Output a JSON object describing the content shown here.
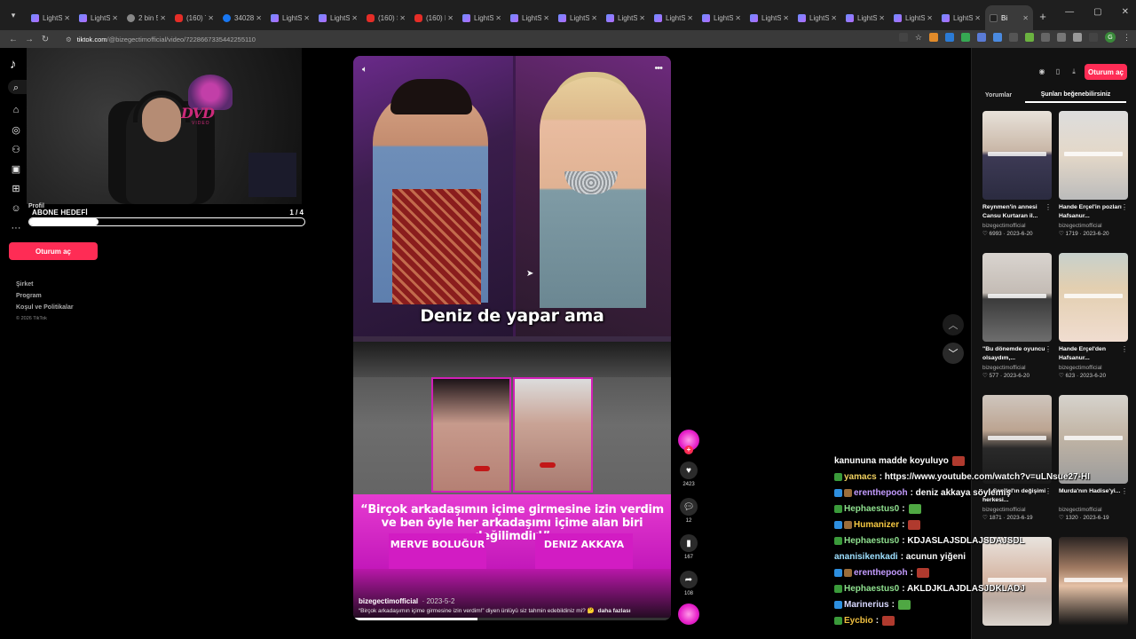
{
  "browser": {
    "tabs": [
      {
        "title": "LightS",
        "icon": "lightstream-icon"
      },
      {
        "title": "LightS",
        "icon": "lightstream-icon"
      },
      {
        "title": "2 bin 5",
        "icon": "globe-icon"
      },
      {
        "title": "(160) T",
        "icon": "youtube-icon"
      },
      {
        "title": "34028",
        "icon": "facebook-icon"
      },
      {
        "title": "LightS",
        "icon": "lightstream-icon"
      },
      {
        "title": "LightS",
        "icon": "lightstream-icon"
      },
      {
        "title": "(160) S",
        "icon": "youtube-icon"
      },
      {
        "title": "(160) I",
        "icon": "youtube-icon"
      },
      {
        "title": "LightS",
        "icon": "lightstream-icon"
      },
      {
        "title": "LightS",
        "icon": "lightstream-icon"
      },
      {
        "title": "LightS",
        "icon": "lightstream-icon"
      },
      {
        "title": "LightS",
        "icon": "lightstream-icon"
      },
      {
        "title": "LightS",
        "icon": "lightstream-icon"
      },
      {
        "title": "LightS",
        "icon": "lightstream-icon"
      },
      {
        "title": "LightS",
        "icon": "lightstream-icon"
      },
      {
        "title": "LightS",
        "icon": "lightstream-icon"
      },
      {
        "title": "LightS",
        "icon": "lightstream-icon"
      },
      {
        "title": "LightS",
        "icon": "lightstream-icon"
      },
      {
        "title": "LightS",
        "icon": "lightstream-icon"
      },
      {
        "title": "Bi",
        "icon": "tiktok-icon",
        "active": true
      }
    ],
    "url_host": "tiktok.com",
    "url_path": "/@bizegectimofficial/video/7228667335442255110"
  },
  "sidebar": {
    "logo": "♪",
    "profile_label": "Profil",
    "login_label": "Oturum aç",
    "footer": [
      "Şirket",
      "Program",
      "Koşul ve Politikalar"
    ],
    "copyright": "© 2026 TikTok"
  },
  "overlay": {
    "dvd_text": "DVD",
    "dvd_sub": "VIDEO",
    "sub_goal_label": "ABONE HEDEFİ",
    "sub_goal_count": "1 / 4",
    "sub_goal_progress": 0.25
  },
  "video": {
    "caption_top": "Deniz de yapar ama",
    "quote": "“Birçok arkadaşımın içime girmesine izin verdim ve ben öyle her arkadaşımı içime alan biri değilimdir!”",
    "name_left": "MERVE BOLUĞUR",
    "name_right": "DENIZ AKKAYA",
    "author": "bizegectimofficial",
    "date": "· 2023-5-2",
    "description": "“Birçok arkadaşımın içime girmesine izin verdim!” diyen ünlüyü siz tahmin edebildiniz mi? 🤔",
    "more": "daha fazlası",
    "progress": 0.39
  },
  "actions": {
    "likes": "2423",
    "comments": "12",
    "saves": "167",
    "shares": "108"
  },
  "right_panel": {
    "login_label": "Oturum aç",
    "tab_comments": "Yorumlar",
    "tab_suggested": "Şunları beğenebilirsiniz",
    "cards": [
      {
        "title": "Reynmen'in annesi Cansu Kurtaran il...",
        "author": "bizegectimofficial",
        "likes": "6993",
        "date": "2023-6-20"
      },
      {
        "title": "Hande Erçel'in pozları Hafsanur...",
        "author": "bizegectimofficial",
        "likes": "1719",
        "date": "2023-6-20"
      },
      {
        "title": "\"Bu dönemde oyuncu olsaydım,...",
        "author": "bizegectimofficial",
        "likes": "577",
        "date": "2023-6-20"
      },
      {
        "title": "Hande Erçel'den Hafsanur...",
        "author": "bizegectimofficial",
        "likes": "623",
        "date": "2023-6-20"
      },
      {
        "title": "...n Sandal'ın değişimi herkesi...",
        "author": "bizegectimofficial",
        "likes": "1871",
        "date": "2023-6-19"
      },
      {
        "title": "Murda'nın Hadise'yi...",
        "author": "bizegectimofficial",
        "likes": "1320",
        "date": "2023-6-19"
      },
      {
        "title": "",
        "author": "",
        "likes": "",
        "date": ""
      },
      {
        "title": "",
        "author": "",
        "likes": "",
        "date": ""
      }
    ]
  },
  "chat": [
    {
      "user": "",
      "msg": "kanununa madde koyuluyo",
      "badges": [],
      "user_color": "#ffffff",
      "emote": "red"
    },
    {
      "user": "yamacs",
      "msg": ": https://www.youtube.com/watch?v=uLNsue27-HI",
      "badges": [
        "green"
      ],
      "user_color": "#f0d060",
      "emote": ""
    },
    {
      "user": "erenthepooh",
      "msg": ": deniz akkaya söylemiş",
      "badges": [
        "blue",
        "brown"
      ],
      "user_color": "#c39bff",
      "emote": ""
    },
    {
      "user": "Hephaestus0",
      "msg": ":",
      "badges": [
        "green"
      ],
      "user_color": "#8fe08f",
      "emote": "green"
    },
    {
      "user": "Humanizer",
      "msg": ":",
      "badges": [
        "blue",
        "brown"
      ],
      "user_color": "#f5c842",
      "emote": "red"
    },
    {
      "user": "Hephaestus0",
      "msg": ": KDJASLAJSDLAJSDAJSDL",
      "badges": [
        "green"
      ],
      "user_color": "#8fe08f",
      "emote": ""
    },
    {
      "user": "ananisikenkadi",
      "msg": ": acunun yiğeni",
      "badges": [],
      "user_color": "#9ee0ff",
      "emote": ""
    },
    {
      "user": "erenthepooh",
      "msg": ":",
      "badges": [
        "blue",
        "brown"
      ],
      "user_color": "#c39bff",
      "emote": "red"
    },
    {
      "user": "Hephaestus0",
      "msg": ": AKLDJKLAJDLASJDKLADJ",
      "badges": [
        "green"
      ],
      "user_color": "#8fe08f",
      "emote": ""
    },
    {
      "user": "Marinerius",
      "msg": ":",
      "badges": [
        "blue"
      ],
      "user_color": "#d8d8ff",
      "emote": "green"
    },
    {
      "user": "Eycbio",
      "msg": ":",
      "badges": [
        "green"
      ],
      "user_color": "#f0c040",
      "emote": "red"
    }
  ]
}
